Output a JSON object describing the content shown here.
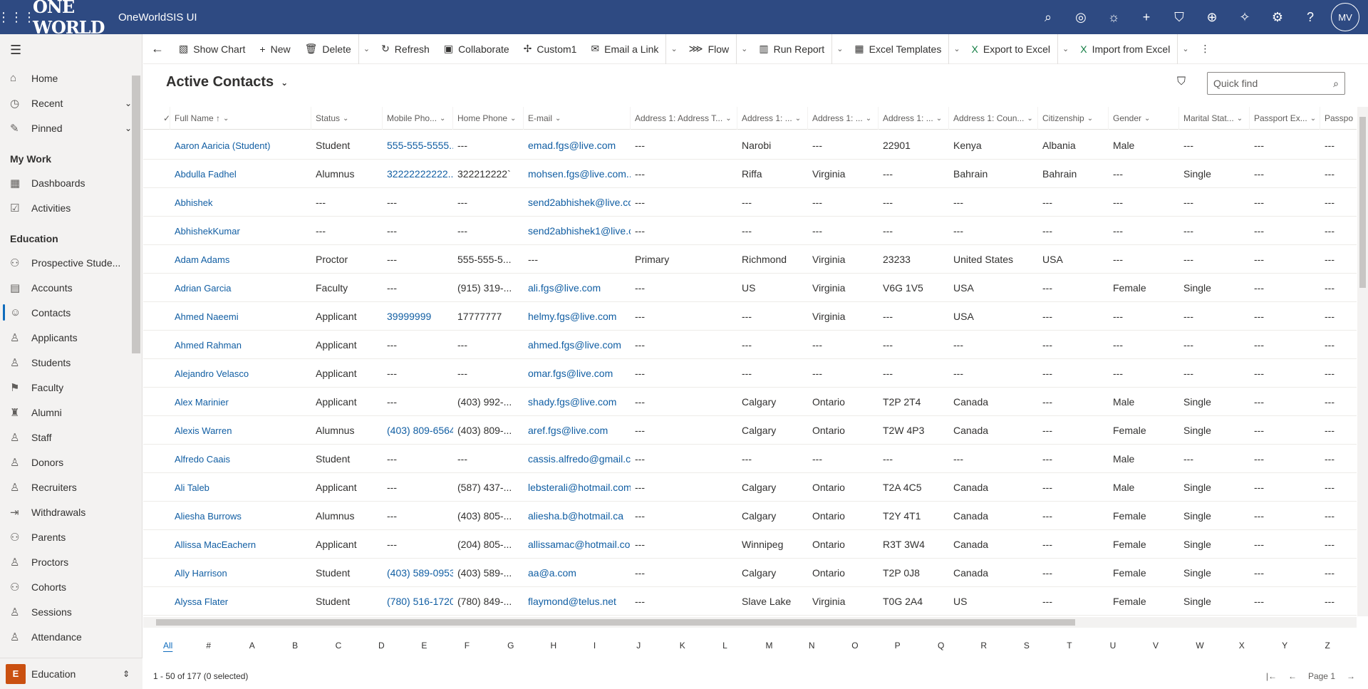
{
  "app": {
    "title": "OneWorldSIS UI",
    "logo_text": "ONE WORLD",
    "user_initials": "MV"
  },
  "header_icons": [
    "search-icon",
    "target-icon",
    "lightbulb-icon",
    "plus-icon",
    "filter-icon",
    "circle-plus-icon",
    "puzzle-icon",
    "gear-icon",
    "help-icon"
  ],
  "sidebar": {
    "top": [
      {
        "label": "Home",
        "icon": "⌂"
      },
      {
        "label": "Recent",
        "icon": "◷",
        "chevron": "⌄"
      },
      {
        "label": "Pinned",
        "icon": "✎",
        "chevron": "⌄"
      }
    ],
    "groups": [
      {
        "title": "My Work",
        "items": [
          {
            "label": "Dashboards",
            "icon": "▦"
          },
          {
            "label": "Activities",
            "icon": "☑"
          }
        ]
      },
      {
        "title": "Education",
        "items": [
          {
            "label": "Prospective Stude...",
            "icon": "⚇"
          },
          {
            "label": "Accounts",
            "icon": "▤"
          },
          {
            "label": "Contacts",
            "icon": "☺",
            "active": true
          },
          {
            "label": "Applicants",
            "icon": "♙"
          },
          {
            "label": "Students",
            "icon": "♙"
          },
          {
            "label": "Faculty",
            "icon": "⚑"
          },
          {
            "label": "Alumni",
            "icon": "♜"
          },
          {
            "label": "Staff",
            "icon": "♙"
          },
          {
            "label": "Donors",
            "icon": "♙"
          },
          {
            "label": "Recruiters",
            "icon": "♙"
          },
          {
            "label": "Withdrawals",
            "icon": "⇥"
          },
          {
            "label": "Parents",
            "icon": "⚇"
          },
          {
            "label": "Proctors",
            "icon": "♙"
          },
          {
            "label": "Cohorts",
            "icon": "⚇"
          },
          {
            "label": "Sessions",
            "icon": "♙"
          },
          {
            "label": "Attendance",
            "icon": "♙"
          }
        ]
      }
    ],
    "area": {
      "badge": "E",
      "label": "Education"
    }
  },
  "commands": [
    {
      "label": "Show Chart",
      "icon": "▧"
    },
    {
      "label": "New",
      "icon": "+"
    },
    {
      "label": "Delete",
      "icon": "🗑"
    },
    {
      "sep": true
    },
    {
      "label": "Refresh",
      "icon": "↻"
    },
    {
      "label": "Collaborate",
      "icon": "▣"
    },
    {
      "label": "Custom1",
      "icon": "✢"
    },
    {
      "label": "Email a Link",
      "icon": "✉"
    },
    {
      "sep": true
    },
    {
      "label": "Flow",
      "icon": "⋙"
    },
    {
      "sep": true
    },
    {
      "label": "Run Report",
      "icon": "▥"
    },
    {
      "sep": true
    },
    {
      "label": "Excel Templates",
      "icon": "▦"
    },
    {
      "sep": true
    },
    {
      "label": "Export to Excel",
      "icon": "X",
      "green": true
    },
    {
      "sep": true
    },
    {
      "label": "Import from Excel",
      "icon": "X",
      "green": true
    },
    {
      "sep": true
    },
    {
      "label": "⋮",
      "icon": ""
    }
  ],
  "view": {
    "title": "Active Contacts",
    "quickfind_placeholder": "Quick find"
  },
  "columns": [
    {
      "label": "Full Name ↑",
      "w": 198
    },
    {
      "label": "Status",
      "w": 100
    },
    {
      "label": "Mobile Pho...",
      "w": 99
    },
    {
      "label": "Home Phone",
      "w": 99
    },
    {
      "label": "E-mail",
      "w": 150
    },
    {
      "label": "Address 1: Address T...",
      "w": 150
    },
    {
      "label": "Address 1: ...",
      "w": 99
    },
    {
      "label": "Address 1: ...",
      "w": 99
    },
    {
      "label": "Address 1: ...",
      "w": 99
    },
    {
      "label": "Address 1: Coun...",
      "w": 125
    },
    {
      "label": "Citizenship",
      "w": 99
    },
    {
      "label": "Gender",
      "w": 99
    },
    {
      "label": "Marital Stat...",
      "w": 99
    },
    {
      "label": "Passport Ex...",
      "w": 99
    },
    {
      "label": "Passpo",
      "w": 60
    }
  ],
  "rows": [
    [
      "Aaron Aaricia (Student)",
      "Student",
      "555-555-5555...",
      "---",
      "emad.fgs@live.com",
      "---",
      "Narobi",
      "---",
      "22901",
      "Kenya",
      "Albania",
      "Male",
      "---",
      "---",
      "---"
    ],
    [
      "Abdulla Fadhel",
      "Alumnus",
      "32222222222...",
      "322212222`",
      "mohsen.fgs@live.com...",
      "---",
      "Riffa",
      "Virginia",
      "---",
      "Bahrain",
      "Bahrain",
      "---",
      "Single",
      "---",
      "---"
    ],
    [
      "Abhishek",
      "---",
      "---",
      "---",
      "send2abhishek@live.cc",
      "---",
      "---",
      "---",
      "---",
      "---",
      "---",
      "---",
      "---",
      "---",
      "---"
    ],
    [
      "AbhishekKumar",
      "---",
      "---",
      "---",
      "send2abhishek1@live.c",
      "---",
      "---",
      "---",
      "---",
      "---",
      "---",
      "---",
      "---",
      "---",
      "---"
    ],
    [
      "Adam Adams",
      "Proctor",
      "---",
      "555-555-5...",
      "---",
      "Primary",
      "Richmond",
      "Virginia",
      "23233",
      "United States",
      "USA",
      "---",
      "---",
      "---",
      "---"
    ],
    [
      "Adrian Garcia",
      "Faculty",
      "---",
      "(915) 319-...",
      "ali.fgs@live.com",
      "---",
      "US",
      "Virginia",
      "V6G 1V5",
      "USA",
      "---",
      "Female",
      "Single",
      "---",
      "---"
    ],
    [
      "Ahmed Naeemi",
      "Applicant",
      "39999999",
      "17777777",
      "helmy.fgs@live.com",
      "---",
      "---",
      "Virginia",
      "---",
      "USA",
      "---",
      "---",
      "---",
      "---",
      "---"
    ],
    [
      "Ahmed Rahman",
      "Applicant",
      "---",
      "---",
      "ahmed.fgs@live.com",
      "---",
      "---",
      "---",
      "---",
      "---",
      "---",
      "---",
      "---",
      "---",
      "---"
    ],
    [
      "Alejandro Velasco",
      "Applicant",
      "---",
      "---",
      "omar.fgs@live.com",
      "---",
      "---",
      "---",
      "---",
      "---",
      "---",
      "---",
      "---",
      "---",
      "---"
    ],
    [
      "Alex Marinier",
      "Applicant",
      "---",
      "(403) 992-...",
      "shady.fgs@live.com",
      "---",
      "Calgary",
      "Ontario",
      "T2P 2T4",
      "Canada",
      "---",
      "Male",
      "Single",
      "---",
      "---"
    ],
    [
      "Alexis Warren",
      "Alumnus",
      "(403) 809-6564",
      "(403) 809-...",
      "aref.fgs@live.com",
      "---",
      "Calgary",
      "Ontario",
      "T2W 4P3",
      "Canada",
      "---",
      "Female",
      "Single",
      "---",
      "---"
    ],
    [
      "Alfredo Caais",
      "Student",
      "---",
      "---",
      "cassis.alfredo@gmail.cc",
      "---",
      "---",
      "---",
      "---",
      "---",
      "---",
      "Male",
      "---",
      "---",
      "---"
    ],
    [
      "Ali Taleb",
      "Applicant",
      "---",
      "(587) 437-...",
      "lebsterali@hotmail.com",
      "---",
      "Calgary",
      "Ontario",
      "T2A 4C5",
      "Canada",
      "---",
      "Male",
      "Single",
      "---",
      "---"
    ],
    [
      "Aliesha Burrows",
      "Alumnus",
      "---",
      "(403) 805-...",
      "aliesha.b@hotmail.ca",
      "---",
      "Calgary",
      "Ontario",
      "T2Y 4T1",
      "Canada",
      "---",
      "Female",
      "Single",
      "---",
      "---"
    ],
    [
      "Allissa MacEachern",
      "Applicant",
      "---",
      "(204) 805-...",
      "allissamac@hotmail.co",
      "---",
      "Winnipeg",
      "Ontario",
      "R3T 3W4",
      "Canada",
      "---",
      "Female",
      "Single",
      "---",
      "---"
    ],
    [
      "Ally Harrison",
      "Student",
      "(403) 589-0953",
      "(403) 589-...",
      "aa@a.com",
      "---",
      "Calgary",
      "Ontario",
      "T2P 0J8",
      "Canada",
      "---",
      "Female",
      "Single",
      "---",
      "---"
    ],
    [
      "Alyssa Flater",
      "Student",
      "(780) 516-1720",
      "(780) 849-...",
      "flaymond@telus.net",
      "---",
      "Slave Lake",
      "Virginia",
      "T0G 2A4",
      "US",
      "---",
      "Female",
      "Single",
      "---",
      "---"
    ]
  ],
  "jumpbar": [
    "All",
    "#",
    "A",
    "B",
    "C",
    "D",
    "E",
    "F",
    "G",
    "H",
    "I",
    "J",
    "K",
    "L",
    "M",
    "N",
    "O",
    "P",
    "Q",
    "R",
    "S",
    "T",
    "U",
    "V",
    "W",
    "X",
    "Y",
    "Z"
  ],
  "footer": {
    "summary": "1 - 50 of 177 (0 selected)",
    "page": "Page 1"
  }
}
